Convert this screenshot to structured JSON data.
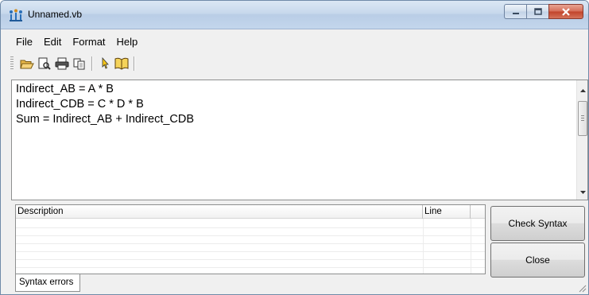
{
  "window": {
    "title": "Unnamed.vb"
  },
  "menu": {
    "items": [
      "File",
      "Edit",
      "Format",
      "Help"
    ]
  },
  "toolbar": {
    "buttons": [
      "open-folder-icon",
      "print-preview-icon",
      "print-icon",
      "copy-icon",
      "help-pointer-icon",
      "help-book-icon"
    ]
  },
  "editor": {
    "lines": [
      "Indirect_AB = A * B",
      "Indirect_CDB = C * D * B",
      "Sum = Indirect_AB + Indirect_CDB"
    ]
  },
  "errors": {
    "columns": {
      "description": "Description",
      "line": "Line"
    },
    "tab_label": "Syntax errors"
  },
  "buttons": {
    "check_syntax": "Check Syntax",
    "close": "Close"
  },
  "colors": {
    "titlebar": "#c7d8ec",
    "close_button": "#c1422a",
    "window_bg": "#f0f0f0"
  }
}
